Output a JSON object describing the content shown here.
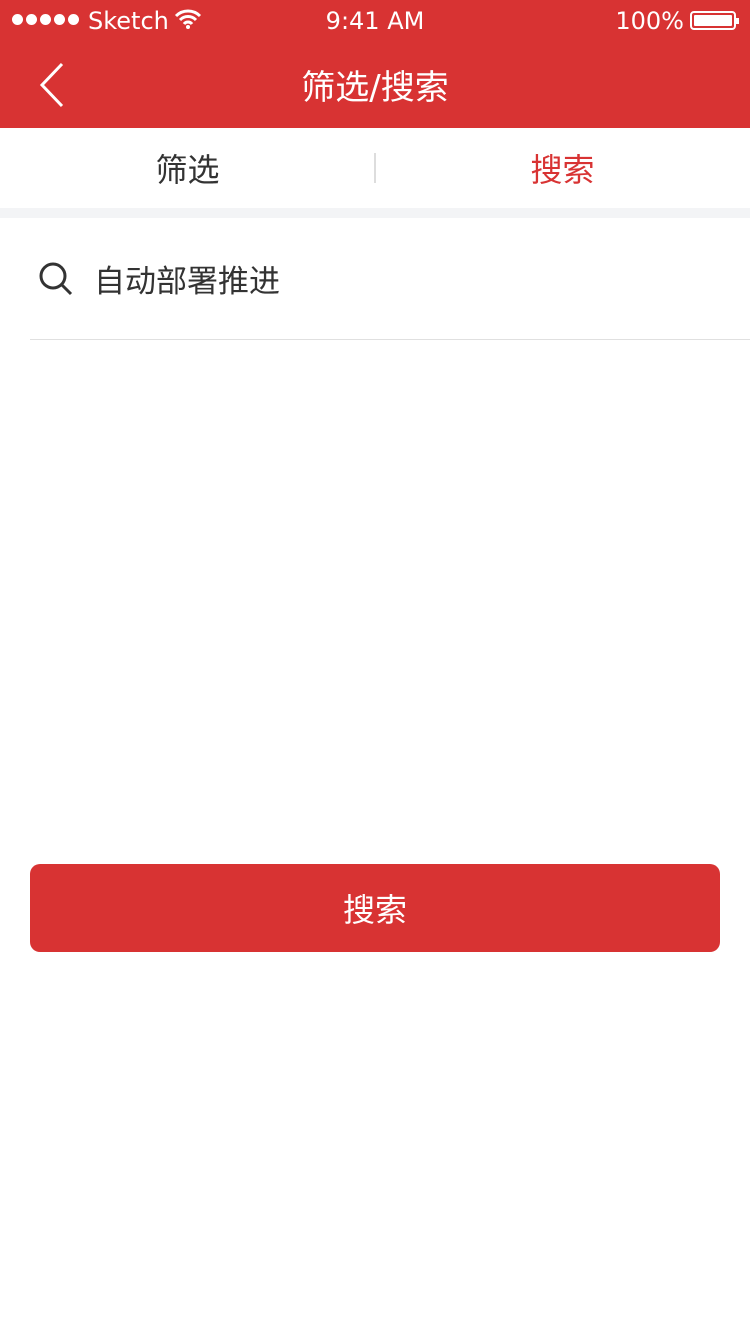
{
  "status": {
    "carrier": "Sketch",
    "time": "9:41 AM",
    "battery": "100%"
  },
  "header": {
    "title": "筛选/搜索"
  },
  "tabs": [
    {
      "label": "筛选"
    },
    {
      "label": "搜索"
    }
  ],
  "search": {
    "value": "自动部署推进"
  },
  "button": {
    "label": "搜索"
  },
  "colors": {
    "brand": "#d83333"
  }
}
